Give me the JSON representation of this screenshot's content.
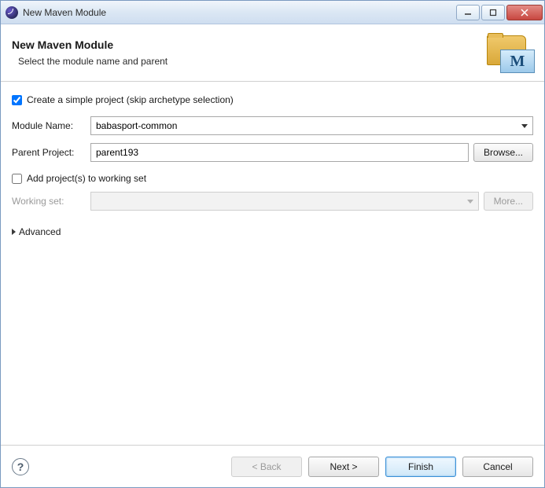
{
  "titlebar": {
    "title": "New Maven Module"
  },
  "header": {
    "title": "New Maven Module",
    "subtitle": "Select the module name and parent"
  },
  "form": {
    "simple_project": {
      "label": "Create a simple project (skip archetype selection)",
      "checked": true
    },
    "module_name": {
      "label": "Module Name:",
      "value": "babasport-common"
    },
    "parent_project": {
      "label": "Parent Project:",
      "value": "parent193",
      "browse": "Browse..."
    },
    "working_set_cb": {
      "label": "Add project(s) to working set",
      "checked": false
    },
    "working_set": {
      "label": "Working set:",
      "value": "",
      "more": "More..."
    },
    "advanced": "Advanced"
  },
  "footer": {
    "back": "< Back",
    "next": "Next >",
    "finish": "Finish",
    "cancel": "Cancel"
  }
}
